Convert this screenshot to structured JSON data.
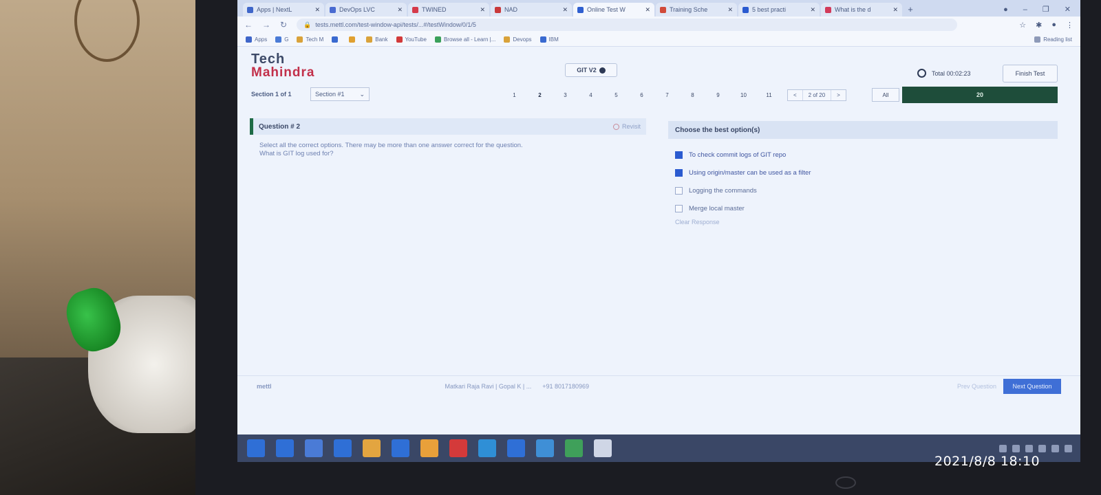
{
  "browser": {
    "tabs": [
      {
        "label": "Apps | NextL",
        "icon_color": "#3f66c9",
        "active": false
      },
      {
        "label": "DevOps LVC",
        "icon_color": "#4a6bd1",
        "active": false
      },
      {
        "label": "TWINED",
        "icon_color": "#d53a4a",
        "active": false
      },
      {
        "label": "NAD",
        "icon_color": "#c9393b",
        "active": false
      },
      {
        "label": "Online Test W",
        "icon_color": "#2f5fd0",
        "active": true
      },
      {
        "label": "Training Sche",
        "icon_color": "#d14a3a",
        "active": false
      },
      {
        "label": "5 best practi",
        "icon_color": "#2a5ad0",
        "active": false
      },
      {
        "label": "What is the d",
        "icon_color": "#d23a5a",
        "active": false
      }
    ],
    "new_tab": "+",
    "url": "tests.mettl.com/test-window-api/tests/...#/testWindow/0/1/5",
    "bookmarks": [
      {
        "label": "Apps",
        "color": "#3f66c9"
      },
      {
        "label": "G",
        "color": "#4a7bd6"
      },
      {
        "label": "Tech M",
        "color": "#d9a23a"
      },
      {
        "label": "",
        "color": "#3a6ad0"
      },
      {
        "label": "",
        "color": "#e0a030"
      },
      {
        "label": "Bank",
        "color": "#d9a23a"
      },
      {
        "label": "YouTube",
        "color": "#d23a3a"
      },
      {
        "label": "Browse all - Learn |...",
        "color": "#3aa05a"
      },
      {
        "label": "Devops",
        "color": "#d9a23a"
      },
      {
        "label": "IBM",
        "color": "#3a6ad0"
      }
    ],
    "reading_list": "Reading list"
  },
  "header": {
    "brand_line1": "Tech",
    "brand_line2": "Mahindra",
    "test_title": "GIT V2",
    "timer_label": "Total 00:02:23",
    "finish_button": "Finish Test"
  },
  "nav": {
    "section_label": "Section 1 of 1",
    "section_select": "Section #1",
    "pages": [
      "1",
      "2",
      "3",
      "4",
      "5",
      "6",
      "7",
      "8",
      "9",
      "10",
      "11"
    ],
    "prev": "<",
    "page_indicator": "2 of 20",
    "next": ">",
    "all_button": "All",
    "progress_value": "20",
    "progress_fraction": 1.0
  },
  "question": {
    "title": "Question # 2",
    "revisit": "Revisit",
    "instruction": "Select all the correct options. There may be more than one answer correct for the question.",
    "text": "What is GIT log used for?"
  },
  "options": {
    "header": "Choose the best option(s)",
    "items": [
      {
        "label": "To check commit logs of GIT repo",
        "checked": true
      },
      {
        "label": "Using origin/master can be used as a filter",
        "checked": true
      },
      {
        "label": "Logging the commands",
        "checked": false
      },
      {
        "label": "Merge local master",
        "checked": false
      }
    ],
    "clear": "Clear Response"
  },
  "footer": {
    "logo": "mettl",
    "candidate": "Matkari Raja Ravi | Gopal K | ...",
    "phone": "+91 8017180969",
    "prev_button": "Prev Question",
    "next_button": "Next Question"
  },
  "taskbar": {
    "icons": [
      "#2f6fd6",
      "#2f6fd6",
      "#4a7bd6",
      "#2f6fd6",
      "#e3a540",
      "#2f6fd6",
      "#e8a03a",
      "#d43a3a",
      "#2f8fd6",
      "#2f6fd6",
      "#3f8fd6",
      "#3fa05a",
      "#cfd6e6"
    ]
  },
  "photo_timestamp": "2021/8/8 18:10"
}
